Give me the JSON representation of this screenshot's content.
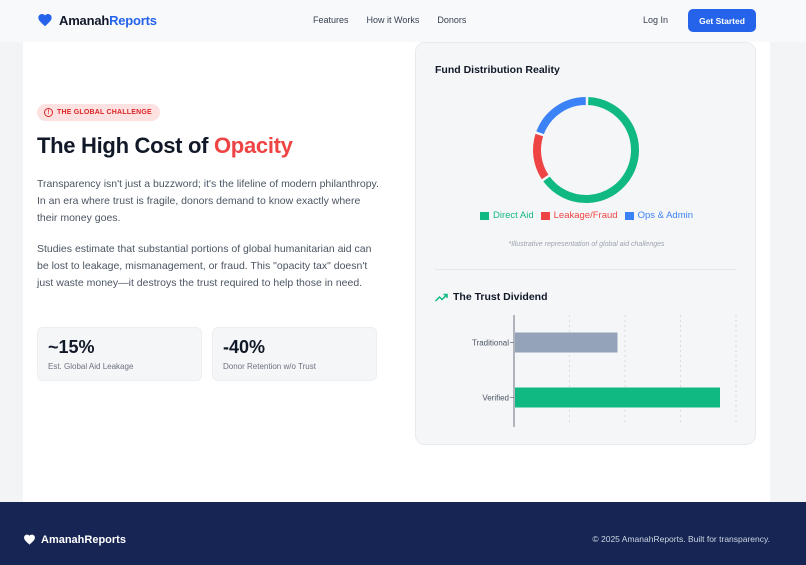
{
  "nav": {
    "brand_primary": "Amanah",
    "brand_accent": "Reports",
    "links": [
      "Features",
      "How it Works",
      "Donors"
    ],
    "login": "Log In",
    "cta": "Get Started"
  },
  "hero": {
    "badge": "THE GLOBAL CHALLENGE",
    "headline_main": "The High Cost of ",
    "headline_accent": "Opacity",
    "paragraph1": "Transparency isn't just a buzzword; it's the lifeline of modern philanthropy. In an era where trust is fragile, donors demand to know exactly where their money goes.",
    "paragraph2": "Studies estimate that substantial portions of global humanitarian aid can be lost to leakage, mismanagement, or fraud. This \"opacity tax\" doesn't just waste money—it destroys the trust required to help those in need.",
    "stats": [
      {
        "value": "~15%",
        "label": "Est. Global Aid Leakage"
      },
      {
        "value": "-40%",
        "label": "Donor Retention w/o Trust"
      }
    ]
  },
  "panel": {
    "title": "Fund Distribution Reality",
    "note": "*Illustrative representation of global aid challenges",
    "trust_title": "The Trust Dividend"
  },
  "chart_data": [
    {
      "type": "pie",
      "title": "Fund Distribution Reality",
      "categories": [
        "Direct Aid",
        "Leakage/Fraud",
        "Ops & Admin"
      ],
      "values": [
        65,
        15,
        20
      ],
      "colors": [
        "#10b981",
        "#ef4444",
        "#3b82f6"
      ]
    },
    {
      "type": "bar",
      "orientation": "horizontal",
      "title": "The Trust Dividend",
      "categories": [
        "Traditional",
        "Verified"
      ],
      "values": [
        50,
        100
      ],
      "xlim": [
        0,
        100
      ],
      "colors": [
        "#94a3b8",
        "#10b981"
      ]
    }
  ],
  "footer": {
    "brand": "AmanahReports",
    "copyright": "© 2025 AmanahReports. Built for transparency."
  },
  "colors": {
    "brand": "#2563eb",
    "accent_red": "#ef4444",
    "footer_bg": "#172554"
  }
}
